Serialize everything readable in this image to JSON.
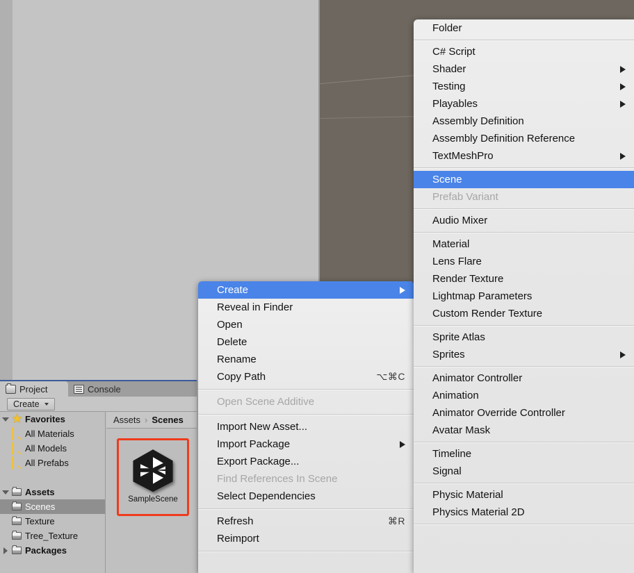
{
  "app": {
    "scene_view_bg": "#c4c4c4",
    "game_view_bg": "#6d675f",
    "menu_bg": "#eaeaea",
    "highlight_color": "#4a84e8",
    "selection_outline": "#ef3b1d"
  },
  "project_panel": {
    "tabs": [
      {
        "label": "Project",
        "icon": "folder-icon",
        "active": true
      },
      {
        "label": "Console",
        "icon": "console-icon",
        "active": false
      }
    ],
    "toolbar": {
      "create_label": "Create"
    },
    "tree": [
      {
        "label": "Favorites",
        "icon": "star-icon",
        "twisty": "down",
        "indent": 0,
        "bold": true,
        "selected": false
      },
      {
        "label": "All Materials",
        "icon": "search-icon",
        "twisty": "none",
        "indent": 1,
        "bold": false,
        "selected": false
      },
      {
        "label": "All Models",
        "icon": "search-icon",
        "twisty": "none",
        "indent": 1,
        "bold": false,
        "selected": false
      },
      {
        "label": "All Prefabs",
        "icon": "search-icon",
        "twisty": "none",
        "indent": 1,
        "bold": false,
        "selected": false
      },
      {
        "label": "",
        "icon": "none",
        "twisty": "none",
        "indent": 0,
        "bold": false,
        "selected": false
      },
      {
        "label": "Assets",
        "icon": "folder-icon",
        "twisty": "down",
        "indent": 0,
        "bold": true,
        "selected": false
      },
      {
        "label": "Scenes",
        "icon": "folder-icon",
        "twisty": "none",
        "indent": 1,
        "bold": false,
        "selected": true
      },
      {
        "label": "Texture",
        "icon": "folder-icon",
        "twisty": "none",
        "indent": 1,
        "bold": false,
        "selected": false
      },
      {
        "label": "Tree_Texture",
        "icon": "folder-icon",
        "twisty": "none",
        "indent": 1,
        "bold": false,
        "selected": false
      },
      {
        "label": "Packages",
        "icon": "folder-icon",
        "twisty": "right",
        "indent": 0,
        "bold": true,
        "selected": false
      }
    ],
    "breadcrumb": {
      "root": "Assets",
      "separator": "›",
      "current": "Scenes"
    },
    "assets": [
      {
        "name": "SampleScene",
        "icon": "unity-scene-icon",
        "selected": true
      }
    ]
  },
  "context_menu": {
    "groups": [
      {
        "items": [
          {
            "label": "Create",
            "submenu": true,
            "disabled": false,
            "highlight": true,
            "shortcut": ""
          },
          {
            "label": "Reveal in Finder",
            "submenu": false,
            "disabled": false,
            "highlight": false,
            "shortcut": ""
          },
          {
            "label": "Open",
            "submenu": false,
            "disabled": false,
            "highlight": false,
            "shortcut": ""
          },
          {
            "label": "Delete",
            "submenu": false,
            "disabled": false,
            "highlight": false,
            "shortcut": ""
          },
          {
            "label": "Rename",
            "submenu": false,
            "disabled": false,
            "highlight": false,
            "shortcut": ""
          },
          {
            "label": "Copy Path",
            "submenu": false,
            "disabled": false,
            "highlight": false,
            "shortcut": "⌥⌘C"
          }
        ]
      },
      {
        "items": [
          {
            "label": "Open Scene Additive",
            "submenu": false,
            "disabled": true,
            "highlight": false,
            "shortcut": ""
          }
        ]
      },
      {
        "items": [
          {
            "label": "Import New Asset...",
            "submenu": false,
            "disabled": false,
            "highlight": false,
            "shortcut": ""
          },
          {
            "label": "Import Package",
            "submenu": true,
            "disabled": false,
            "highlight": false,
            "shortcut": ""
          },
          {
            "label": "Export Package...",
            "submenu": false,
            "disabled": false,
            "highlight": false,
            "shortcut": ""
          },
          {
            "label": "Find References In Scene",
            "submenu": false,
            "disabled": true,
            "highlight": false,
            "shortcut": ""
          },
          {
            "label": "Select Dependencies",
            "submenu": false,
            "disabled": false,
            "highlight": false,
            "shortcut": ""
          }
        ]
      },
      {
        "items": [
          {
            "label": "Refresh",
            "submenu": false,
            "disabled": false,
            "highlight": false,
            "shortcut": "⌘R"
          },
          {
            "label": "Reimport",
            "submenu": false,
            "disabled": false,
            "highlight": false,
            "shortcut": ""
          }
        ]
      }
    ]
  },
  "create_submenu": {
    "groups": [
      {
        "items": [
          {
            "label": "Folder",
            "submenu": false,
            "disabled": false,
            "highlight": false,
            "shortcut": ""
          }
        ]
      },
      {
        "items": [
          {
            "label": "C# Script",
            "submenu": false,
            "disabled": false,
            "highlight": false,
            "shortcut": ""
          },
          {
            "label": "Shader",
            "submenu": true,
            "disabled": false,
            "highlight": false,
            "shortcut": ""
          },
          {
            "label": "Testing",
            "submenu": true,
            "disabled": false,
            "highlight": false,
            "shortcut": ""
          },
          {
            "label": "Playables",
            "submenu": true,
            "disabled": false,
            "highlight": false,
            "shortcut": ""
          },
          {
            "label": "Assembly Definition",
            "submenu": false,
            "disabled": false,
            "highlight": false,
            "shortcut": ""
          },
          {
            "label": "Assembly Definition Reference",
            "submenu": false,
            "disabled": false,
            "highlight": false,
            "shortcut": ""
          },
          {
            "label": "TextMeshPro",
            "submenu": true,
            "disabled": false,
            "highlight": false,
            "shortcut": ""
          }
        ]
      },
      {
        "items": [
          {
            "label": "Scene",
            "submenu": false,
            "disabled": false,
            "highlight": true,
            "shortcut": ""
          },
          {
            "label": "Prefab Variant",
            "submenu": false,
            "disabled": true,
            "highlight": false,
            "shortcut": ""
          }
        ]
      },
      {
        "items": [
          {
            "label": "Audio Mixer",
            "submenu": false,
            "disabled": false,
            "highlight": false,
            "shortcut": ""
          }
        ]
      },
      {
        "items": [
          {
            "label": "Material",
            "submenu": false,
            "disabled": false,
            "highlight": false,
            "shortcut": ""
          },
          {
            "label": "Lens Flare",
            "submenu": false,
            "disabled": false,
            "highlight": false,
            "shortcut": ""
          },
          {
            "label": "Render Texture",
            "submenu": false,
            "disabled": false,
            "highlight": false,
            "shortcut": ""
          },
          {
            "label": "Lightmap Parameters",
            "submenu": false,
            "disabled": false,
            "highlight": false,
            "shortcut": ""
          },
          {
            "label": "Custom Render Texture",
            "submenu": false,
            "disabled": false,
            "highlight": false,
            "shortcut": ""
          }
        ]
      },
      {
        "items": [
          {
            "label": "Sprite Atlas",
            "submenu": false,
            "disabled": false,
            "highlight": false,
            "shortcut": ""
          },
          {
            "label": "Sprites",
            "submenu": true,
            "disabled": false,
            "highlight": false,
            "shortcut": ""
          }
        ]
      },
      {
        "items": [
          {
            "label": "Animator Controller",
            "submenu": false,
            "disabled": false,
            "highlight": false,
            "shortcut": ""
          },
          {
            "label": "Animation",
            "submenu": false,
            "disabled": false,
            "highlight": false,
            "shortcut": ""
          },
          {
            "label": "Animator Override Controller",
            "submenu": false,
            "disabled": false,
            "highlight": false,
            "shortcut": ""
          },
          {
            "label": "Avatar Mask",
            "submenu": false,
            "disabled": false,
            "highlight": false,
            "shortcut": ""
          }
        ]
      },
      {
        "items": [
          {
            "label": "Timeline",
            "submenu": false,
            "disabled": false,
            "highlight": false,
            "shortcut": ""
          },
          {
            "label": "Signal",
            "submenu": false,
            "disabled": false,
            "highlight": false,
            "shortcut": ""
          }
        ]
      },
      {
        "items": [
          {
            "label": "Physic Material",
            "submenu": false,
            "disabled": false,
            "highlight": false,
            "shortcut": ""
          },
          {
            "label": "Physics Material 2D",
            "submenu": false,
            "disabled": false,
            "highlight": false,
            "shortcut": ""
          }
        ]
      }
    ]
  }
}
